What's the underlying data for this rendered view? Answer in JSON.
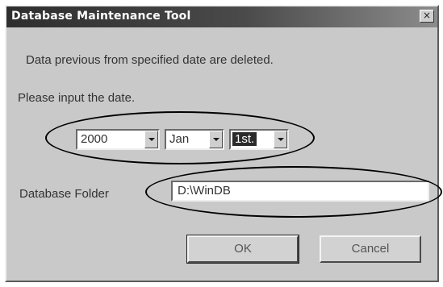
{
  "window": {
    "title": "Database Maintenance Tool",
    "close_label": "×"
  },
  "message": {
    "line1": "Data previous from specified date are deleted.",
    "line2": "Please input the date."
  },
  "date": {
    "year": "2000",
    "month": "Jan",
    "day": "1st."
  },
  "folder": {
    "label": "Database Folder",
    "value": "D:\\WinDB"
  },
  "buttons": {
    "ok": "OK",
    "cancel": "Cancel"
  }
}
